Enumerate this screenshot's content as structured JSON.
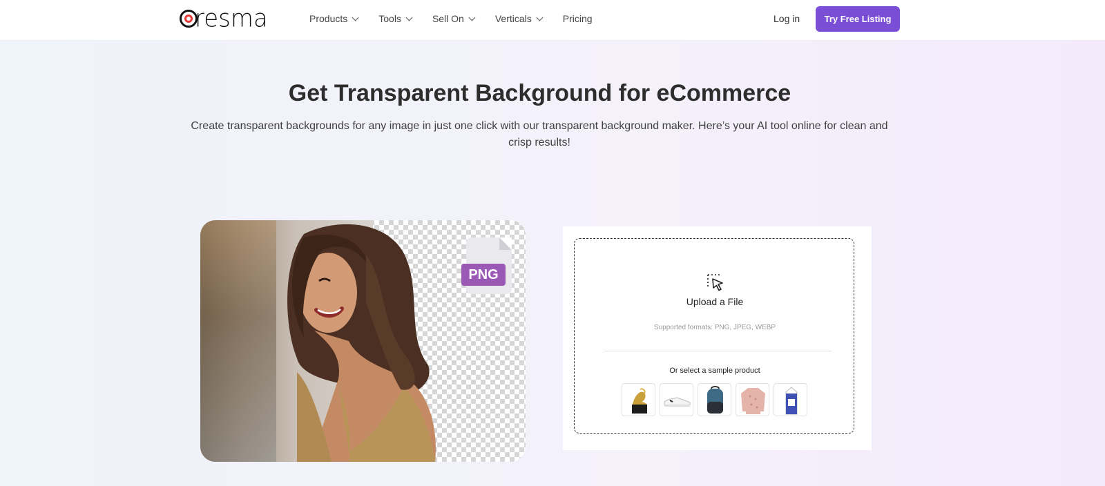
{
  "brand": {
    "name": "Dresma",
    "logo_text": "resma",
    "accent_color": "#7a4fd6",
    "logo_red": "#e53935"
  },
  "nav": {
    "items": [
      {
        "label": "Products",
        "has_dropdown": true
      },
      {
        "label": "Tools",
        "has_dropdown": true
      },
      {
        "label": "Sell On",
        "has_dropdown": true
      },
      {
        "label": "Verticals",
        "has_dropdown": true
      },
      {
        "label": "Pricing",
        "has_dropdown": false
      }
    ],
    "login_label": "Log in",
    "cta_label": "Try Free Listing"
  },
  "hero": {
    "title": "Get Transparent Background for eCommerce",
    "subtitle": "Create transparent backgrounds for any image in just one click with our transparent background maker. Here’s your AI tool online for clean and crisp results!"
  },
  "preview": {
    "badge": "PNG",
    "badge_color": "#9b59b6"
  },
  "upload": {
    "icon": "cursor-select-icon",
    "label": "Upload a File",
    "formats": "Supported formats: PNG, JPEG, WEBP",
    "sample_label": "Or select a sample product",
    "samples": [
      {
        "name": "gold-trophy-icon"
      },
      {
        "name": "white-sneaker-icon"
      },
      {
        "name": "backpack-icon"
      },
      {
        "name": "pink-sweater-icon"
      },
      {
        "name": "milk-carton-icon"
      }
    ]
  }
}
